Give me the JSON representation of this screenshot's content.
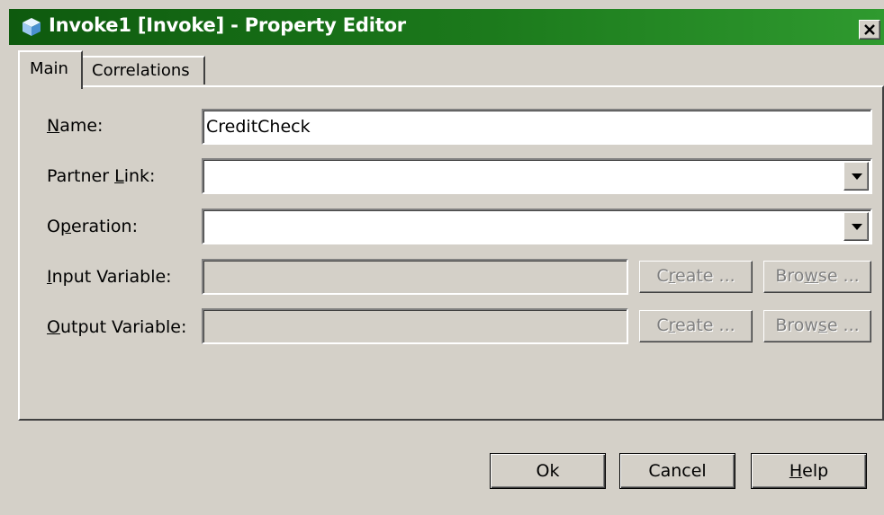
{
  "window": {
    "title": "Invoke1 [Invoke] - Property Editor",
    "icon": "cube-icon",
    "close_icon": "close-icon"
  },
  "tabs": [
    {
      "label": "Main",
      "active": true
    },
    {
      "label": "Correlations",
      "active": false
    }
  ],
  "form": {
    "name": {
      "label_pre": "",
      "label_key": "N",
      "label_post": "ame:",
      "value": "CreditCheck"
    },
    "partner_link": {
      "label_pre": "Partner ",
      "label_key": "L",
      "label_post": "ink:",
      "value": ""
    },
    "operation": {
      "label_pre": "O",
      "label_key": "p",
      "label_post": "eration:",
      "value": ""
    },
    "input_variable": {
      "label_pre": "",
      "label_key": "I",
      "label_post": "nput Variable:",
      "value": ""
    },
    "output_variable": {
      "label_pre": "",
      "label_key": "O",
      "label_post": "utput Variable:",
      "value": ""
    }
  },
  "variable_buttons": {
    "create_pre": "C",
    "create_key": "r",
    "create_post": "eate ...",
    "browse_pre": "Bro",
    "browse_key": "w",
    "browse_post": "se ...",
    "browse2_pre": "Brow",
    "browse2_key": "s",
    "browse2_post": "e ..."
  },
  "footer": {
    "ok": "Ok",
    "cancel": "Cancel",
    "help_key": "H",
    "help_post": "elp"
  },
  "colors": {
    "titlebar_start": "#0e5a0e",
    "titlebar_end": "#2f9a2f",
    "dialog_face": "#d4d0c8",
    "disabled_text": "#808080"
  }
}
